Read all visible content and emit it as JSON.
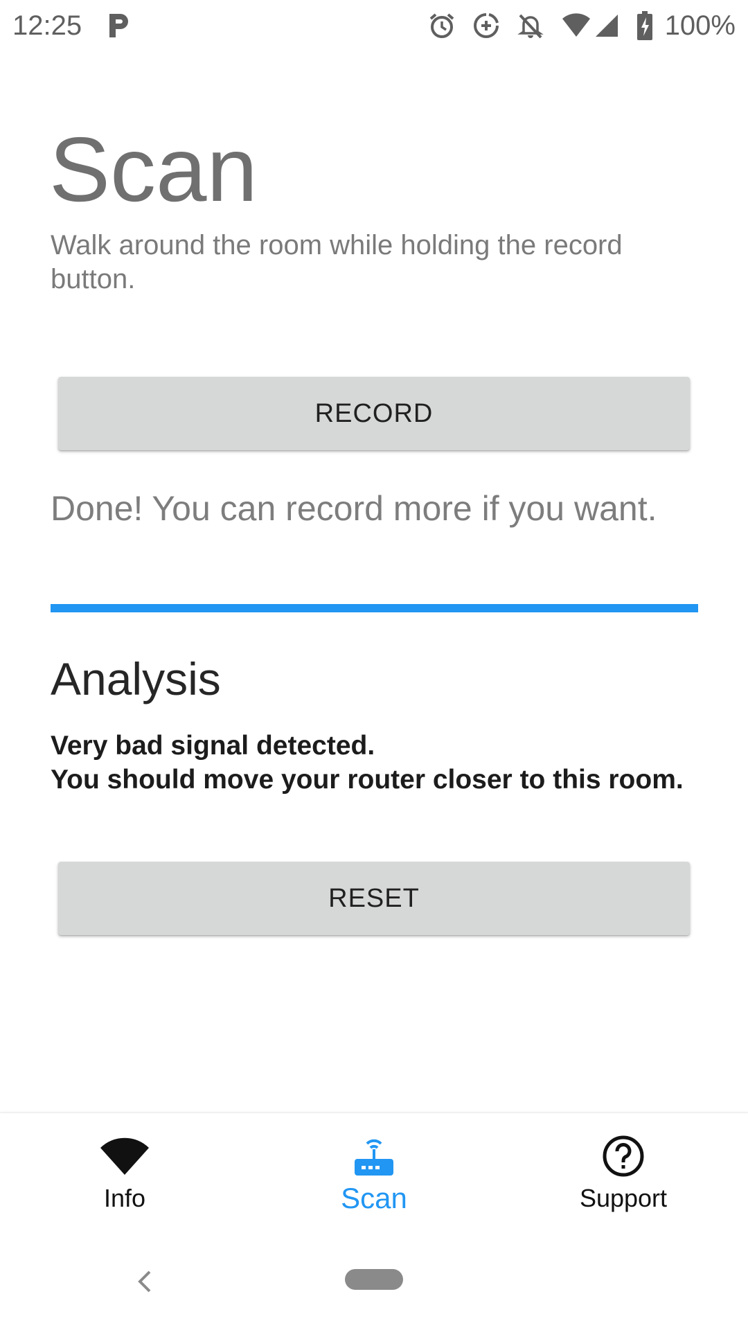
{
  "status_bar": {
    "time": "12:25",
    "battery_text": "100%",
    "icons": [
      "parking-icon",
      "alarm-icon",
      "data-saver-icon",
      "notifications-off-icon",
      "wifi-icon",
      "cell-signal-icon",
      "battery-charging-icon"
    ]
  },
  "scan": {
    "title": "Scan",
    "description": "Walk around the room while holding the record button.",
    "record_button": "RECORD",
    "status_message": "Done! You can record more if you want.",
    "progress": 1.0
  },
  "analysis": {
    "title": "Analysis",
    "result_line1": "Very bad signal detected.",
    "result_line2": "You should move your router closer to this room.",
    "reset_button": "RESET"
  },
  "bottom_nav": {
    "items": [
      {
        "label": "Info",
        "icon": "wifi-icon",
        "active": false
      },
      {
        "label": "Scan",
        "icon": "router-icon",
        "active": true
      },
      {
        "label": "Support",
        "icon": "help-circle-icon",
        "active": false
      }
    ]
  },
  "colors": {
    "accent": "#2196f3",
    "button_bg": "#d6d7d7",
    "title_gray": "#707070"
  }
}
